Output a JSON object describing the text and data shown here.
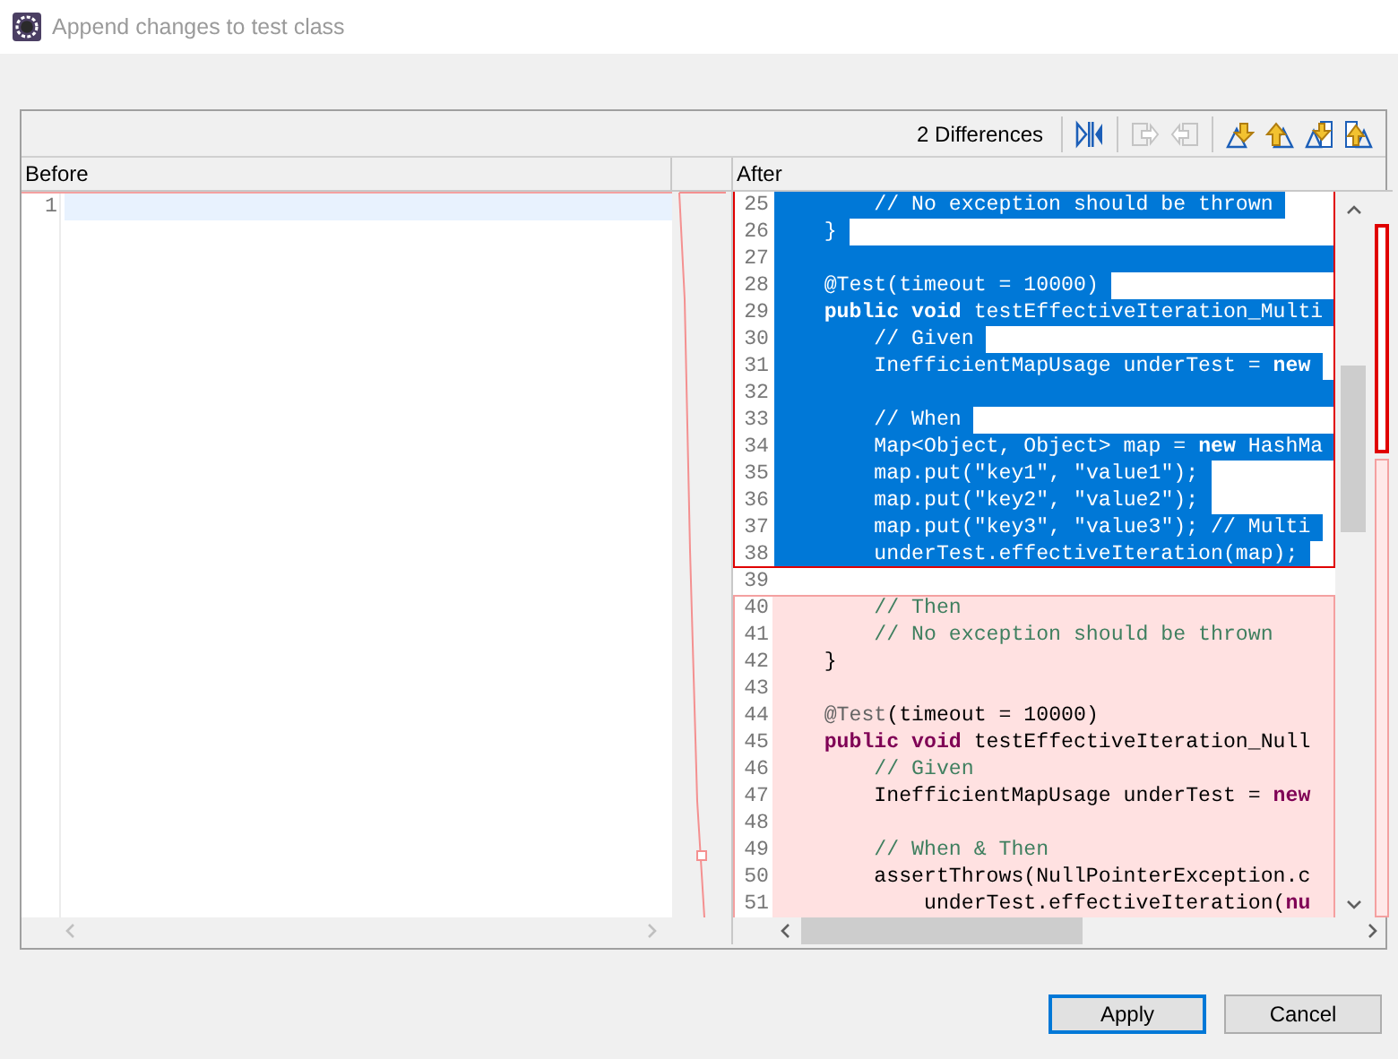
{
  "window": {
    "title": "Append changes to test class"
  },
  "toolbar": {
    "summary": "2 Differences",
    "groups": [
      [
        {
          "kind": "compare",
          "disabled": false
        }
      ],
      [
        {
          "kind": "copy-right",
          "disabled": true
        },
        {
          "kind": "copy-left",
          "disabled": true
        }
      ],
      [
        {
          "kind": "next-diff",
          "disabled": false
        },
        {
          "kind": "prev-diff",
          "disabled": false
        },
        {
          "kind": "next-change",
          "disabled": false
        },
        {
          "kind": "prev-change",
          "disabled": false
        }
      ]
    ]
  },
  "before": {
    "header": "Before",
    "lines": [
      {
        "number": "1",
        "current": true
      }
    ]
  },
  "after": {
    "header": "After",
    "blocks": [
      {
        "kind": "hunk",
        "selected": true,
        "lines": [
          {
            "number": "25",
            "segments": [
              {
                "kind": "comment",
                "text": "        // No exception should be thrown"
              }
            ]
          },
          {
            "number": "26",
            "segments": [
              {
                "kind": "plain",
                "text": "    }"
              }
            ]
          },
          {
            "number": "27"
          },
          {
            "number": "28",
            "segments": [
              {
                "kind": "annotation",
                "text": "    @Test"
              },
              {
                "kind": "plain",
                "text": "(timeout = 10000)"
              }
            ]
          },
          {
            "number": "29",
            "segments": [
              {
                "kind": "keyword",
                "text": "    public void"
              },
              {
                "kind": "plain",
                "text": " testEffectiveIteration_Multi"
              }
            ]
          },
          {
            "number": "30",
            "segments": [
              {
                "kind": "comment",
                "text": "        // Given"
              }
            ]
          },
          {
            "number": "31",
            "segments": [
              {
                "kind": "plain",
                "text": "        InefficientMapUsage underTest = "
              },
              {
                "kind": "keyword",
                "text": "new"
              }
            ]
          },
          {
            "number": "32"
          },
          {
            "number": "33",
            "segments": [
              {
                "kind": "comment",
                "text": "        // When"
              }
            ]
          },
          {
            "number": "34",
            "segments": [
              {
                "kind": "plain",
                "text": "        Map<Object, Object> map = "
              },
              {
                "kind": "keyword",
                "text": "new"
              },
              {
                "kind": "plain",
                "text": " HashMa"
              }
            ]
          },
          {
            "number": "35",
            "segments": [
              {
                "kind": "plain",
                "text": "        map.put("
              },
              {
                "kind": "string",
                "text": "\"key1\""
              },
              {
                "kind": "plain",
                "text": ", "
              },
              {
                "kind": "string",
                "text": "\"value1\""
              },
              {
                "kind": "plain",
                "text": ");"
              }
            ]
          },
          {
            "number": "36",
            "segments": [
              {
                "kind": "plain",
                "text": "        map.put("
              },
              {
                "kind": "string",
                "text": "\"key2\""
              },
              {
                "kind": "plain",
                "text": ", "
              },
              {
                "kind": "string",
                "text": "\"value2\""
              },
              {
                "kind": "plain",
                "text": ");"
              }
            ]
          },
          {
            "number": "37",
            "segments": [
              {
                "kind": "plain",
                "text": "        map.put("
              },
              {
                "kind": "string",
                "text": "\"key3\""
              },
              {
                "kind": "plain",
                "text": ", "
              },
              {
                "kind": "string",
                "text": "\"value3\""
              },
              {
                "kind": "plain",
                "text": "); "
              },
              {
                "kind": "comment",
                "text": "// Multi"
              }
            ]
          },
          {
            "number": "38",
            "segments": [
              {
                "kind": "plain",
                "text": "        underTest.effectiveIteration(map);"
              }
            ]
          }
        ]
      },
      {
        "kind": "plain",
        "lines": [
          {
            "number": "39"
          }
        ]
      },
      {
        "kind": "hunk",
        "selected": false,
        "lines": [
          {
            "number": "40",
            "segments": [
              {
                "kind": "comment",
                "text": "        // Then"
              }
            ]
          },
          {
            "number": "41",
            "segments": [
              {
                "kind": "comment",
                "text": "        // No exception should be thrown"
              }
            ]
          },
          {
            "number": "42",
            "segments": [
              {
                "kind": "plain",
                "text": "    }"
              }
            ]
          },
          {
            "number": "43"
          },
          {
            "number": "44",
            "segments": [
              {
                "kind": "annotation",
                "text": "    @Test"
              },
              {
                "kind": "plain",
                "text": "(timeout = 10000)"
              }
            ]
          },
          {
            "number": "45",
            "segments": [
              {
                "kind": "keyword",
                "text": "    public void"
              },
              {
                "kind": "plain",
                "text": " testEffectiveIteration_Null"
              }
            ]
          },
          {
            "number": "46",
            "segments": [
              {
                "kind": "comment",
                "text": "        // Given"
              }
            ]
          },
          {
            "number": "47",
            "segments": [
              {
                "kind": "plain",
                "text": "        InefficientMapUsage underTest = "
              },
              {
                "kind": "keyword",
                "text": "new"
              }
            ]
          },
          {
            "number": "48"
          },
          {
            "number": "49",
            "segments": [
              {
                "kind": "comment",
                "text": "        // When & Then"
              }
            ]
          },
          {
            "number": "50",
            "segments": [
              {
                "kind": "plain",
                "text": "        assertThrows(NullPointerException.c"
              }
            ]
          },
          {
            "number": "51",
            "segments": [
              {
                "kind": "plain",
                "text": "            underTest.effectiveIteration("
              },
              {
                "kind": "keyword",
                "text": "nu"
              }
            ]
          }
        ]
      }
    ]
  },
  "buttons": [
    {
      "label": "Apply",
      "default": true
    },
    {
      "label": "Cancel",
      "default": false
    }
  ]
}
